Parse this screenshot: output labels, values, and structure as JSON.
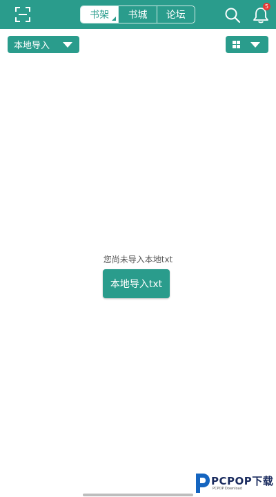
{
  "header": {
    "tabs": [
      {
        "label": "书架",
        "active": true
      },
      {
        "label": "书城",
        "active": false
      },
      {
        "label": "论坛",
        "active": false
      }
    ],
    "icons": {
      "scan": "scan-icon",
      "search": "search-icon",
      "notification": "bell-icon"
    },
    "notification_count": "5"
  },
  "toolbar": {
    "source_dropdown_label": "本地导入",
    "view_toggle_icon": "grid-icon"
  },
  "empty_state": {
    "message": "您尚未导入本地txt",
    "import_button_label": "本地导入txt"
  },
  "watermark": {
    "text": "PCPOP下载",
    "subtext": "PCPOP Download"
  },
  "colors": {
    "accent": "#2a9c8c",
    "badge": "#e53935"
  }
}
